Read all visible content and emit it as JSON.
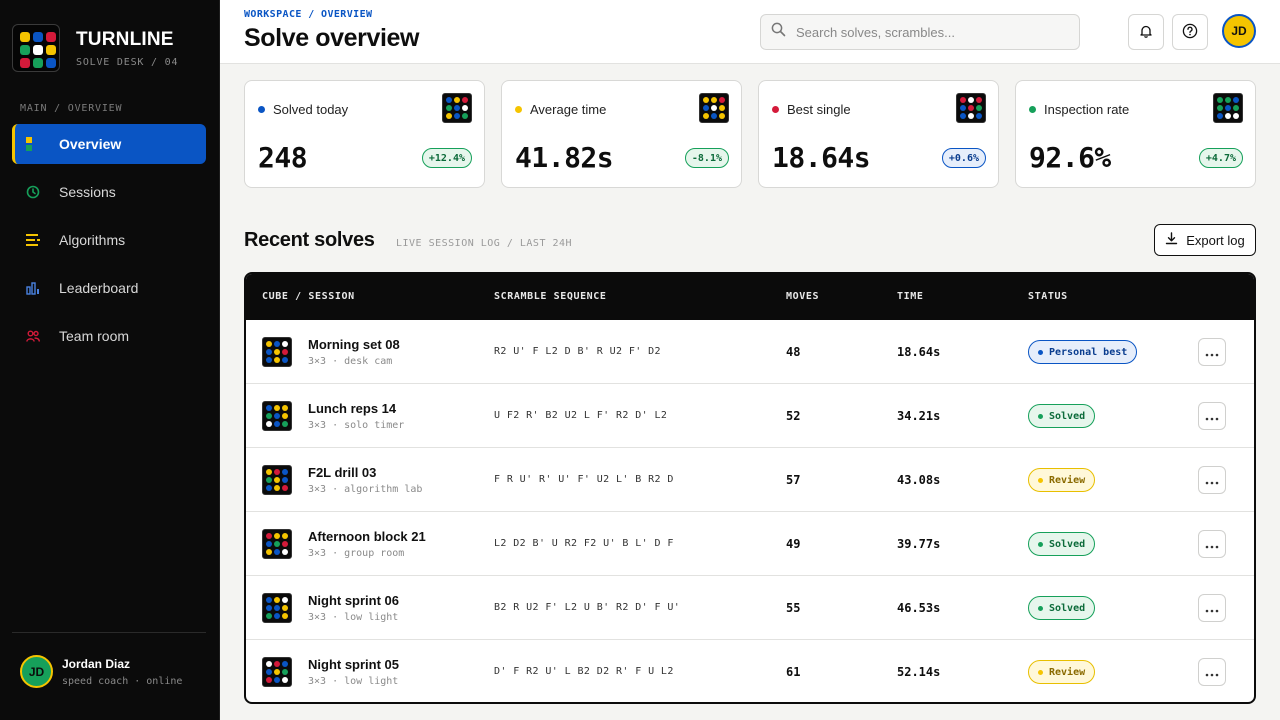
{
  "brand": {
    "name": "TURNLINE",
    "subtitle": "SOLVE DESK / 04"
  },
  "sidebar": {
    "section_label": "MAIN / OVERVIEW",
    "items": [
      {
        "label": "Overview",
        "icon": "grid-icon",
        "active": true
      },
      {
        "label": "Sessions",
        "icon": "clock-icon",
        "active": false
      },
      {
        "label": "Algorithms",
        "icon": "list-icon",
        "active": false
      },
      {
        "label": "Leaderboard",
        "icon": "bar-chart-icon",
        "active": false
      },
      {
        "label": "Team room",
        "icon": "users-icon",
        "active": false
      }
    ],
    "user": {
      "initials": "JD",
      "name": "Jordan Diaz",
      "role": "speed coach · online"
    }
  },
  "header": {
    "breadcrumb": "WORKSPACE / OVERVIEW",
    "title": "Solve overview",
    "search_placeholder": "Search solves, scrambles...",
    "avatar_initials": "JD"
  },
  "stats": [
    {
      "label": "Solved today",
      "value": "248",
      "delta": "+12.4%",
      "dot_color": "#0a55c4",
      "delta_style": "green"
    },
    {
      "label": "Average time",
      "value": "41.82s",
      "delta": "-8.1%",
      "dot_color": "#f5c400",
      "delta_style": "green"
    },
    {
      "label": "Best single",
      "value": "18.64s",
      "delta": "+0.6%",
      "dot_color": "#d41a3a",
      "delta_style": "blue"
    },
    {
      "label": "Inspection rate",
      "value": "92.6%",
      "delta": "+4.7%",
      "dot_color": "#16a05a",
      "delta_style": "green"
    }
  ],
  "recent": {
    "title": "Recent solves",
    "subtitle": "LIVE SESSION LOG / LAST 24H",
    "export_label": "Export log",
    "columns": [
      "CUBE / SESSION",
      "SCRAMBLE SEQUENCE",
      "MOVES",
      "TIME",
      "STATUS"
    ],
    "rows": [
      {
        "name": "Morning set 08",
        "meta": "3×3 · desk cam",
        "scramble": "R2 U' F L2 D B' R U2 F' D2",
        "moves": "48",
        "time": "18.64s",
        "status": "Personal best",
        "status_style": "best"
      },
      {
        "name": "Lunch reps 14",
        "meta": "3×3 · solo timer",
        "scramble": "U F2 R' B2 U2 L F' R2 D' L2",
        "moves": "52",
        "time": "34.21s",
        "status": "Solved",
        "status_style": "solved"
      },
      {
        "name": "F2L drill 03",
        "meta": "3×3 · algorithm lab",
        "scramble": "F R U' R' U' F' U2 L' B R2 D",
        "moves": "57",
        "time": "43.08s",
        "status": "Review",
        "status_style": "review"
      },
      {
        "name": "Afternoon block 21",
        "meta": "3×3 · group room",
        "scramble": "L2 D2 B' U R2 F2 U' B L' D F",
        "moves": "49",
        "time": "39.77s",
        "status": "Solved",
        "status_style": "solved"
      },
      {
        "name": "Night sprint 06",
        "meta": "3×3 · low light",
        "scramble": "B2 R U2 F' L2 U B' R2 D' F U'",
        "moves": "55",
        "time": "46.53s",
        "status": "Solved",
        "status_style": "solved"
      },
      {
        "name": "Night sprint 05",
        "meta": "3×3 · low light",
        "scramble": "D' F R2 U' L B2 D2 R' F U L2",
        "moves": "61",
        "time": "52.14s",
        "status": "Review",
        "status_style": "review"
      }
    ]
  },
  "colors": {
    "blue": "#0a55c4",
    "yellow": "#f5c400",
    "red": "#d41a3a",
    "green": "#16a05a",
    "white": "#ffffff"
  }
}
